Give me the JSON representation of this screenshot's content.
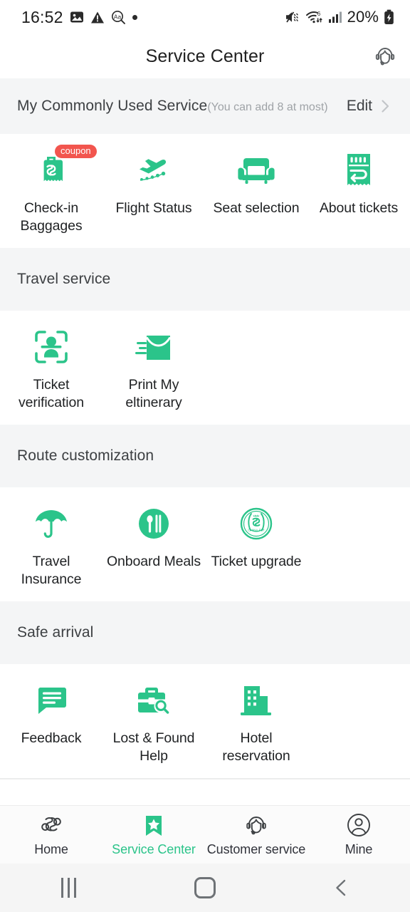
{
  "status_bar": {
    "time": "16:52",
    "battery_percent": "20%",
    "left_icons": [
      "photo-icon",
      "warning-triangle-icon",
      "text-search-icon",
      "dot-indicator"
    ],
    "right_icons": [
      "mute-icon",
      "wifi-6-icon",
      "cellular-signal-icon",
      "battery-charging-icon"
    ]
  },
  "app_bar": {
    "title": "Service Center",
    "action_icon": "headset-icon"
  },
  "commonly_used": {
    "title": "My Commonly Used Service",
    "hint": "(You can add 8 at most)",
    "edit_label": "Edit",
    "items": [
      {
        "label": "Check-in Baggages",
        "icon": "suitcase-icon",
        "badge": "coupon"
      },
      {
        "label": "Flight Status",
        "icon": "airplane-departure-icon",
        "badge": ""
      },
      {
        "label": "Seat selection",
        "icon": "armchair-icon",
        "badge": ""
      },
      {
        "label": "About tickets",
        "icon": "ticket-receipt-icon",
        "badge": ""
      }
    ]
  },
  "sections": [
    {
      "title": "Travel service",
      "items": [
        {
          "label": "Ticket verification",
          "icon": "face-scan-icon"
        },
        {
          "label": "Print My eltinerary",
          "icon": "envelope-icon"
        }
      ]
    },
    {
      "title": "Route customization",
      "items": [
        {
          "label": "Travel Insurance",
          "icon": "umbrella-icon"
        },
        {
          "label": "Onboard Meals",
          "icon": "cutlery-circle-icon"
        },
        {
          "label": "Ticket upgrade",
          "icon": "airline-emblem-icon"
        }
      ]
    },
    {
      "title": "Safe arrival",
      "items": [
        {
          "label": "Feedback",
          "icon": "chat-bubble-icon"
        },
        {
          "label": "Lost & Found Help",
          "icon": "briefcase-search-icon"
        },
        {
          "label": "Hotel reservation",
          "icon": "buildings-icon"
        }
      ]
    }
  ],
  "tab_bar": {
    "items": [
      {
        "label": "Home",
        "icon": "spiral-logo-icon",
        "active": false
      },
      {
        "label": "Service Center",
        "icon": "bookmark-star-icon",
        "active": true
      },
      {
        "label": "Customer service",
        "icon": "headset-icon",
        "active": false
      },
      {
        "label": "Mine",
        "icon": "user-circle-icon",
        "active": false
      }
    ]
  },
  "system_nav": {
    "recents": "recents-icon",
    "home": "home-icon",
    "back": "back-icon"
  },
  "colors": {
    "accent_green": "#2bc48a",
    "badge_red": "#f2554e",
    "band_gray": "#f4f5f6",
    "text_primary": "#1f2123"
  }
}
